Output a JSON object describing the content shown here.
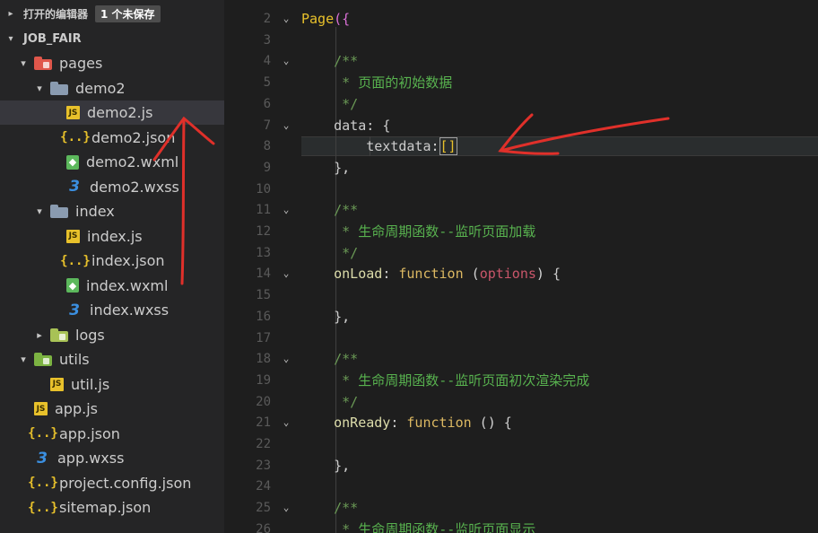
{
  "sidebar": {
    "open_editors": {
      "title": "打开的编辑器",
      "badge": "1 个未保存"
    },
    "project": {
      "title": "JOB_FAIR"
    },
    "tree": [
      {
        "label": "pages",
        "kind": "folder-pages",
        "depth": 1,
        "chevron": "▾"
      },
      {
        "label": "demo2",
        "kind": "folder-plain",
        "depth": 2,
        "chevron": "▾"
      },
      {
        "label": "demo2.js",
        "kind": "js",
        "depth": 3,
        "selected": true
      },
      {
        "label": "demo2.json",
        "kind": "json",
        "depth": 3
      },
      {
        "label": "demo2.wxml",
        "kind": "wxml",
        "depth": 3
      },
      {
        "label": "demo2.wxss",
        "kind": "wxss",
        "depth": 3
      },
      {
        "label": "index",
        "kind": "folder-plain",
        "depth": 2,
        "chevron": "▾"
      },
      {
        "label": "index.js",
        "kind": "js",
        "depth": 3
      },
      {
        "label": "index.json",
        "kind": "json",
        "depth": 3
      },
      {
        "label": "index.wxml",
        "kind": "wxml",
        "depth": 3
      },
      {
        "label": "index.wxss",
        "kind": "wxss",
        "depth": 3
      },
      {
        "label": "logs",
        "kind": "folder-logs",
        "depth": 2,
        "chevron": "▸"
      },
      {
        "label": "utils",
        "kind": "folder-utils",
        "depth": 1,
        "chevron": "▾"
      },
      {
        "label": "util.js",
        "kind": "js",
        "depth": 2
      },
      {
        "label": "app.js",
        "kind": "js",
        "depth": 1
      },
      {
        "label": "app.json",
        "kind": "json",
        "depth": 1
      },
      {
        "label": "app.wxss",
        "kind": "wxss",
        "depth": 1
      },
      {
        "label": "project.config.json",
        "kind": "json",
        "depth": 1
      },
      {
        "label": "sitemap.json",
        "kind": "json",
        "depth": 1
      }
    ]
  },
  "icons": {
    "js": "JS",
    "json": "{..}",
    "wxml": "◆",
    "wxss": "3"
  },
  "editor": {
    "lines": [
      {
        "n": "2",
        "fold": "⌄",
        "tokens": [
          [
            "c-page",
            "Page"
          ],
          [
            "c-pagep",
            "({"
          ]
        ]
      },
      {
        "n": "3",
        "tokens": []
      },
      {
        "n": "4",
        "fold": "⌄",
        "tokens": [
          [
            "c-comment",
            "    /**"
          ]
        ]
      },
      {
        "n": "5",
        "tokens": [
          [
            "c-comment",
            "     * "
          ],
          [
            "c-comment-cn",
            "页面的初始数据"
          ]
        ]
      },
      {
        "n": "6",
        "tokens": [
          [
            "c-comment",
            "     */"
          ]
        ]
      },
      {
        "n": "7",
        "fold": "⌄",
        "tokens": [
          [
            "c-prop",
            "    data"
          ],
          [
            "c-punc",
            ": "
          ],
          [
            "c-brace",
            "{"
          ]
        ]
      },
      {
        "n": "8",
        "tokens": [
          [
            "c-prop",
            "        textdata"
          ],
          [
            "c-punc",
            ":"
          ],
          [
            "c-bracket",
            "[]"
          ]
        ]
      },
      {
        "n": "9",
        "tokens": [
          [
            "c-brace",
            "    }"
          ],
          [
            "c-punc",
            ","
          ]
        ]
      },
      {
        "n": "10",
        "tokens": []
      },
      {
        "n": "11",
        "fold": "⌄",
        "tokens": [
          [
            "c-comment",
            "    /**"
          ]
        ]
      },
      {
        "n": "12",
        "tokens": [
          [
            "c-comment",
            "     * "
          ],
          [
            "c-comment-cn",
            "生命周期函数--监听页面加载"
          ]
        ]
      },
      {
        "n": "13",
        "tokens": [
          [
            "c-comment",
            "     */"
          ]
        ]
      },
      {
        "n": "14",
        "fold": "⌄",
        "tokens": [
          [
            "c-func",
            "    onLoad"
          ],
          [
            "c-punc",
            ": "
          ],
          [
            "c-kw",
            "function"
          ],
          [
            "c-punc",
            " ("
          ],
          [
            "c-param",
            "options"
          ],
          [
            "c-punc",
            ") "
          ],
          [
            "c-brace",
            "{"
          ]
        ]
      },
      {
        "n": "15",
        "tokens": []
      },
      {
        "n": "16",
        "tokens": [
          [
            "c-brace",
            "    }"
          ],
          [
            "c-punc",
            ","
          ]
        ]
      },
      {
        "n": "17",
        "tokens": []
      },
      {
        "n": "18",
        "fold": "⌄",
        "tokens": [
          [
            "c-comment",
            "    /**"
          ]
        ]
      },
      {
        "n": "19",
        "tokens": [
          [
            "c-comment",
            "     * "
          ],
          [
            "c-comment-cn",
            "生命周期函数--监听页面初次渲染完成"
          ]
        ]
      },
      {
        "n": "20",
        "tokens": [
          [
            "c-comment",
            "     */"
          ]
        ]
      },
      {
        "n": "21",
        "fold": "⌄",
        "tokens": [
          [
            "c-func",
            "    onReady"
          ],
          [
            "c-punc",
            ": "
          ],
          [
            "c-kw",
            "function"
          ],
          [
            "c-punc",
            " () "
          ],
          [
            "c-brace",
            "{"
          ]
        ]
      },
      {
        "n": "22",
        "tokens": []
      },
      {
        "n": "23",
        "tokens": [
          [
            "c-brace",
            "    }"
          ],
          [
            "c-punc",
            ","
          ]
        ]
      },
      {
        "n": "24",
        "tokens": []
      },
      {
        "n": "25",
        "fold": "⌄",
        "tokens": [
          [
            "c-comment",
            "    /**"
          ]
        ]
      },
      {
        "n": "26",
        "tokens": [
          [
            "c-comment",
            "     * "
          ],
          [
            "c-comment-cn",
            "生命周期函数--监听页面显示"
          ]
        ]
      }
    ]
  },
  "colors": {
    "sidebar_bg": "#252526",
    "editor_bg": "#1e1e1e",
    "selection_bg": "#37373d",
    "annotation_red": "#e0302a"
  }
}
